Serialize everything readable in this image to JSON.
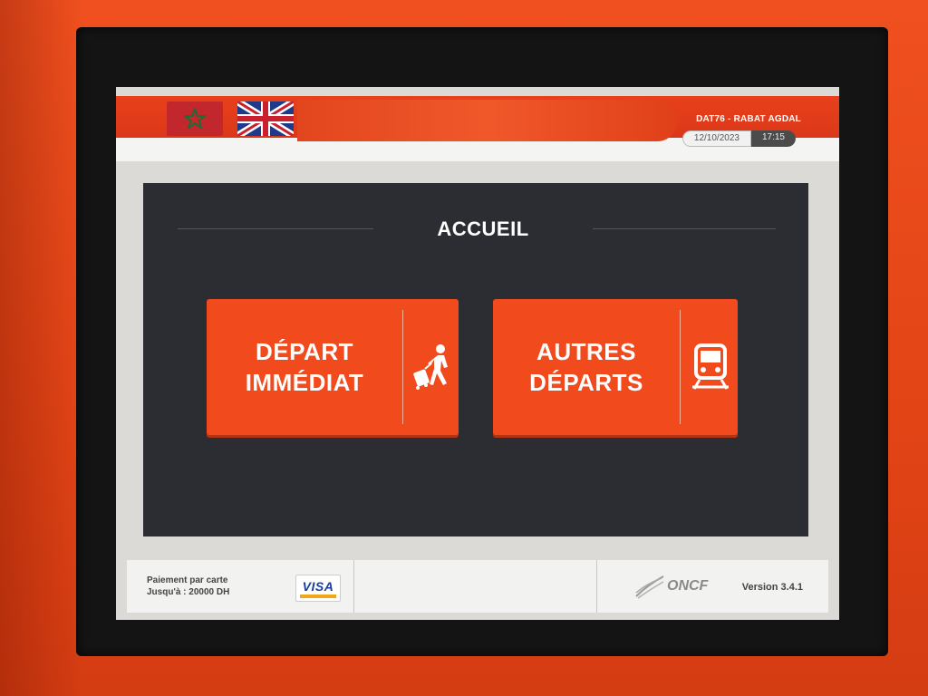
{
  "header": {
    "flags": [
      {
        "name": "morocco-flag",
        "color": "#c1272d"
      },
      {
        "name": "uk-flag"
      }
    ],
    "station_code": "DAT76",
    "station_separator": " - ",
    "station_name": "RABAT AGDAL",
    "date": "12/10/2023",
    "time": "17:15"
  },
  "main": {
    "title": "ACCUEIL",
    "buttons": [
      {
        "line1": "DÉPART",
        "line2": "IMMÉDIAT",
        "icon": "traveler-with-luggage-icon"
      },
      {
        "line1": "AUTRES",
        "line2": "DÉPARTS",
        "icon": "train-icon"
      }
    ]
  },
  "footer": {
    "payment_line1": "Paiement par carte",
    "payment_line2": "Jusqu'à : 20000 DH",
    "card_brand": "VISA",
    "logo_text": "ONCF",
    "version": "Version 3.4.1"
  },
  "colors": {
    "casing": "#e8461c",
    "accent": "#f14a1c",
    "panel": "#2c2d33"
  }
}
